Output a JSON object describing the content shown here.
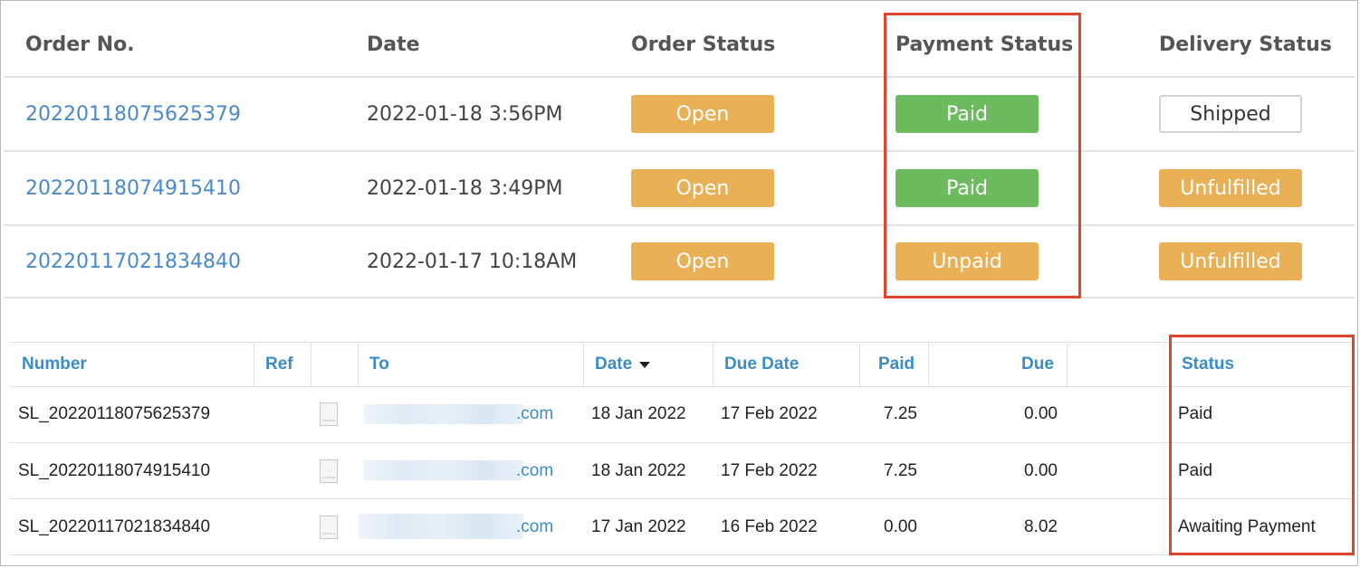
{
  "orders_table": {
    "headers": [
      "Order No.",
      "Date",
      "Order Status",
      "Payment Status",
      "Delivery Status"
    ],
    "rows": [
      {
        "order_no": "20220118075625379",
        "date": "2022-01-18 3:56PM",
        "order_status": "Open",
        "payment_status": "Paid",
        "delivery_status": "Shipped"
      },
      {
        "order_no": "20220118074915410",
        "date": "2022-01-18 3:49PM",
        "order_status": "Open",
        "payment_status": "Paid",
        "delivery_status": "Unfulfilled"
      },
      {
        "order_no": "20220117021834840",
        "date": "2022-01-17 10:18AM",
        "order_status": "Open",
        "payment_status": "Unpaid",
        "delivery_status": "Unfulfilled"
      }
    ]
  },
  "invoices_table": {
    "headers": {
      "number": "Number",
      "ref": "Ref",
      "to": "To",
      "date": "Date",
      "due_date": "Due Date",
      "paid": "Paid",
      "due": "Due",
      "status": "Status"
    },
    "rows": [
      {
        "number": "SL_20220118075625379",
        "to_suffix": ".com",
        "date": "18 Jan 2022",
        "due_date": "17 Feb 2022",
        "paid": "7.25",
        "due": "0.00",
        "status": "Paid"
      },
      {
        "number": "SL_20220118074915410",
        "to_suffix": ".com",
        "date": "18 Jan 2022",
        "due_date": "17 Feb 2022",
        "paid": "7.25",
        "due": "0.00",
        "status": "Paid"
      },
      {
        "number": "SL_20220117021834840",
        "to_suffix": ".com",
        "date": "17 Jan 2022",
        "due_date": "16 Feb 2022",
        "paid": "0.00",
        "due": "8.02",
        "status": "Awaiting Payment"
      }
    ]
  },
  "colors": {
    "link": "#4a8ac9",
    "badge_orange": "#e9b056",
    "badge_green": "#6dbb5f",
    "highlight_red": "#e0442b"
  },
  "icons": {
    "invoice_doc": "document-icon",
    "sort": "sort-desc-icon"
  }
}
